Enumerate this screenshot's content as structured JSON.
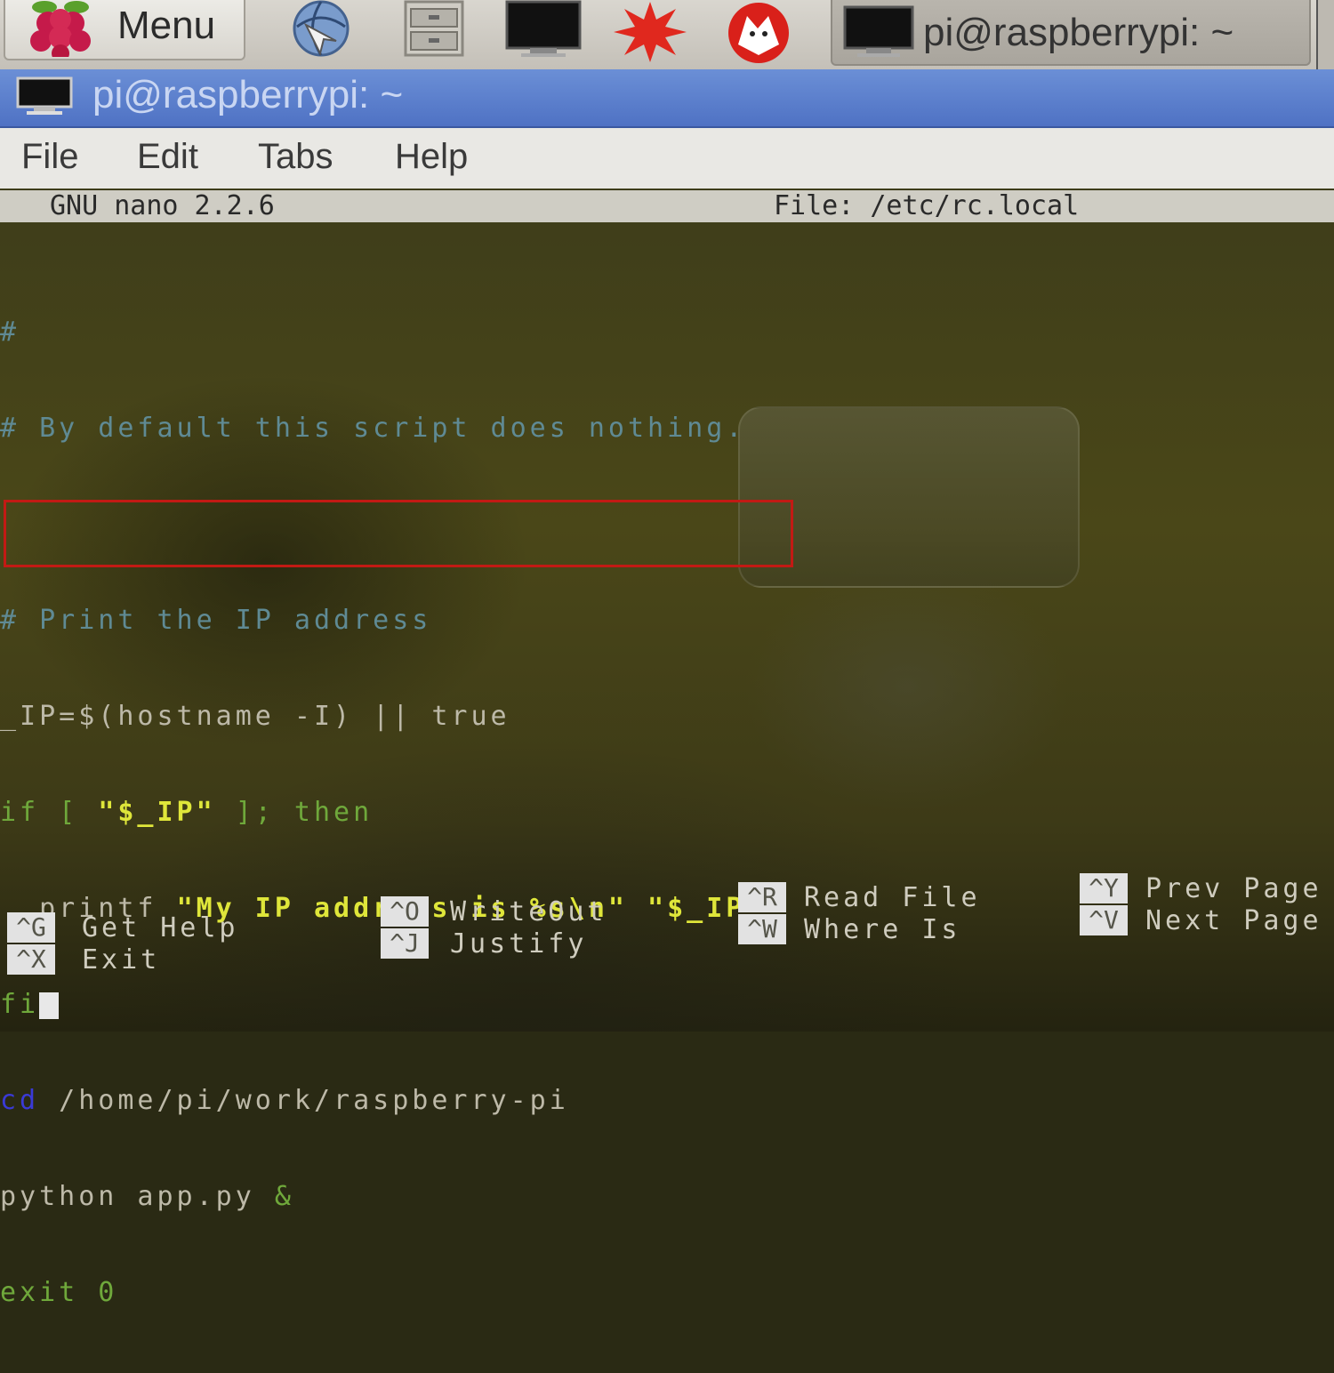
{
  "taskbar": {
    "menu_label": "Menu",
    "task_label": "pi@raspberrypi: ~",
    "launchers": [
      "browser-icon",
      "file-manager-icon",
      "terminal-icon",
      "mathematica-icon",
      "wolfram-icon"
    ]
  },
  "window": {
    "title": "pi@raspberrypi: ~"
  },
  "menubar": {
    "items": [
      "File",
      "Edit",
      "Tabs",
      "Help"
    ]
  },
  "nano": {
    "version": "GNU nano 2.2.6",
    "file": "File: /etc/rc.local",
    "lines": {
      "l1": "#",
      "l2": "# By default this script does nothing.",
      "l3": "# Print the IP address",
      "l4a": "_IP=",
      "l4b": "$(hostname -I) || true",
      "l5a": "if [ ",
      "l5b": "\"$_IP\"",
      "l5c": " ]; then",
      "l6a": "  printf ",
      "l6b": "\"My IP address is %s\\n\" \"$_IP\"",
      "l7": "fi",
      "l8a": "cd",
      "l8b": " /home/pi/work/raspberry-pi",
      "l9a": "python app.py ",
      "l9b": "&",
      "l10": "exit 0"
    },
    "shortcuts": {
      "get_help_key": "^G",
      "get_help": "Get Help",
      "exit_key": "^X",
      "exit": "Exit",
      "writeout_key": "^O",
      "writeout": "WriteOut",
      "justify_key": "^J",
      "justify": "Justify",
      "read_file_key": "^R",
      "read_file": "Read File",
      "where_is_key": "^W",
      "where_is": "Where Is",
      "prev_page_key": "^Y",
      "prev_page": "Prev Page",
      "next_page_key": "^V",
      "next_page": "Next Page"
    }
  },
  "colors": {
    "titlebar": "#5a7dcf",
    "terminal_bg": "#45421a",
    "highlight_box": "#c21a14",
    "string_yellow": "#dfe63a",
    "keyword_green": "#6fa83b",
    "comment_teal": "#5f8a94"
  }
}
